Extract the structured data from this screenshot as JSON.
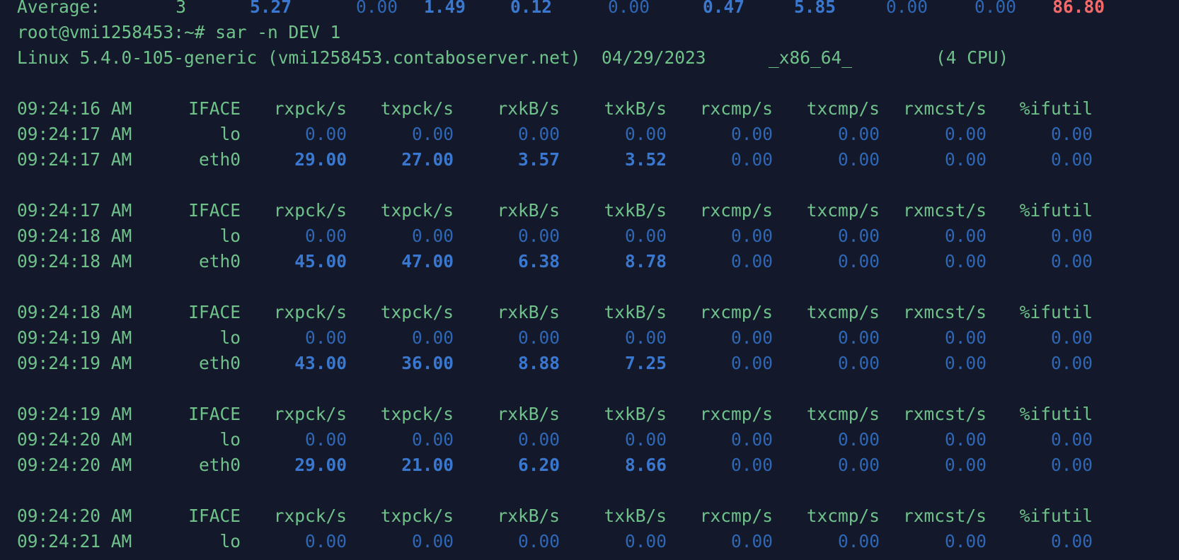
{
  "terminal": {
    "average_line": {
      "label": "Average:",
      "values": [
        {
          "text": "3",
          "style": "g"
        },
        {
          "text": "5.27",
          "style": "bb"
        },
        {
          "text": "0.00",
          "style": "b"
        },
        {
          "text": "1.49",
          "style": "bb"
        },
        {
          "text": "0.12",
          "style": "bb"
        },
        {
          "text": "0.00",
          "style": "b"
        },
        {
          "text": "0.47",
          "style": "bb"
        },
        {
          "text": "5.85",
          "style": "bb"
        },
        {
          "text": "0.00",
          "style": "b"
        },
        {
          "text": "0.00",
          "style": "b"
        },
        {
          "text": "86.80",
          "style": "red"
        }
      ]
    },
    "prompt_line": "root@vmi1258453:~# sar -n DEV 1",
    "system_line": "Linux 5.4.0-105-generic (vmi1258453.contaboserver.net)  04/29/2023      _x86_64_        (4 CPU)",
    "columns": [
      "IFACE",
      "rxpck/s",
      "txpck/s",
      "rxkB/s",
      "txkB/s",
      "rxcmp/s",
      "txcmp/s",
      "rxmcst/s",
      "%ifutil"
    ],
    "blocks": [
      {
        "header_time": "09:24:16 AM",
        "rows": [
          {
            "time": "09:24:17 AM",
            "iface": "lo",
            "values": [
              "0.00",
              "0.00",
              "0.00",
              "0.00",
              "0.00",
              "0.00",
              "0.00",
              "0.00"
            ]
          },
          {
            "time": "09:24:17 AM",
            "iface": "eth0",
            "values": [
              "29.00",
              "27.00",
              "3.57",
              "3.52",
              "0.00",
              "0.00",
              "0.00",
              "0.00"
            ]
          }
        ]
      },
      {
        "header_time": "09:24:17 AM",
        "rows": [
          {
            "time": "09:24:18 AM",
            "iface": "lo",
            "values": [
              "0.00",
              "0.00",
              "0.00",
              "0.00",
              "0.00",
              "0.00",
              "0.00",
              "0.00"
            ]
          },
          {
            "time": "09:24:18 AM",
            "iface": "eth0",
            "values": [
              "45.00",
              "47.00",
              "6.38",
              "8.78",
              "0.00",
              "0.00",
              "0.00",
              "0.00"
            ]
          }
        ]
      },
      {
        "header_time": "09:24:18 AM",
        "rows": [
          {
            "time": "09:24:19 AM",
            "iface": "lo",
            "values": [
              "0.00",
              "0.00",
              "0.00",
              "0.00",
              "0.00",
              "0.00",
              "0.00",
              "0.00"
            ]
          },
          {
            "time": "09:24:19 AM",
            "iface": "eth0",
            "values": [
              "43.00",
              "36.00",
              "8.88",
              "7.25",
              "0.00",
              "0.00",
              "0.00",
              "0.00"
            ]
          }
        ]
      },
      {
        "header_time": "09:24:19 AM",
        "rows": [
          {
            "time": "09:24:20 AM",
            "iface": "lo",
            "values": [
              "0.00",
              "0.00",
              "0.00",
              "0.00",
              "0.00",
              "0.00",
              "0.00",
              "0.00"
            ]
          },
          {
            "time": "09:24:20 AM",
            "iface": "eth0",
            "values": [
              "29.00",
              "21.00",
              "6.20",
              "8.66",
              "0.00",
              "0.00",
              "0.00",
              "0.00"
            ]
          }
        ]
      },
      {
        "header_time": "09:24:20 AM",
        "rows": [
          {
            "time": "09:24:21 AM",
            "iface": "lo",
            "values": [
              "0.00",
              "0.00",
              "0.00",
              "0.00",
              "0.00",
              "0.00",
              "0.00",
              "0.00"
            ]
          }
        ]
      }
    ],
    "colors": {
      "background": "#13182a",
      "text_green": "#6fc28a",
      "value_blue": "#2f67b4",
      "value_blue_bold": "#3a78d0",
      "value_red": "#f26a6a"
    }
  }
}
